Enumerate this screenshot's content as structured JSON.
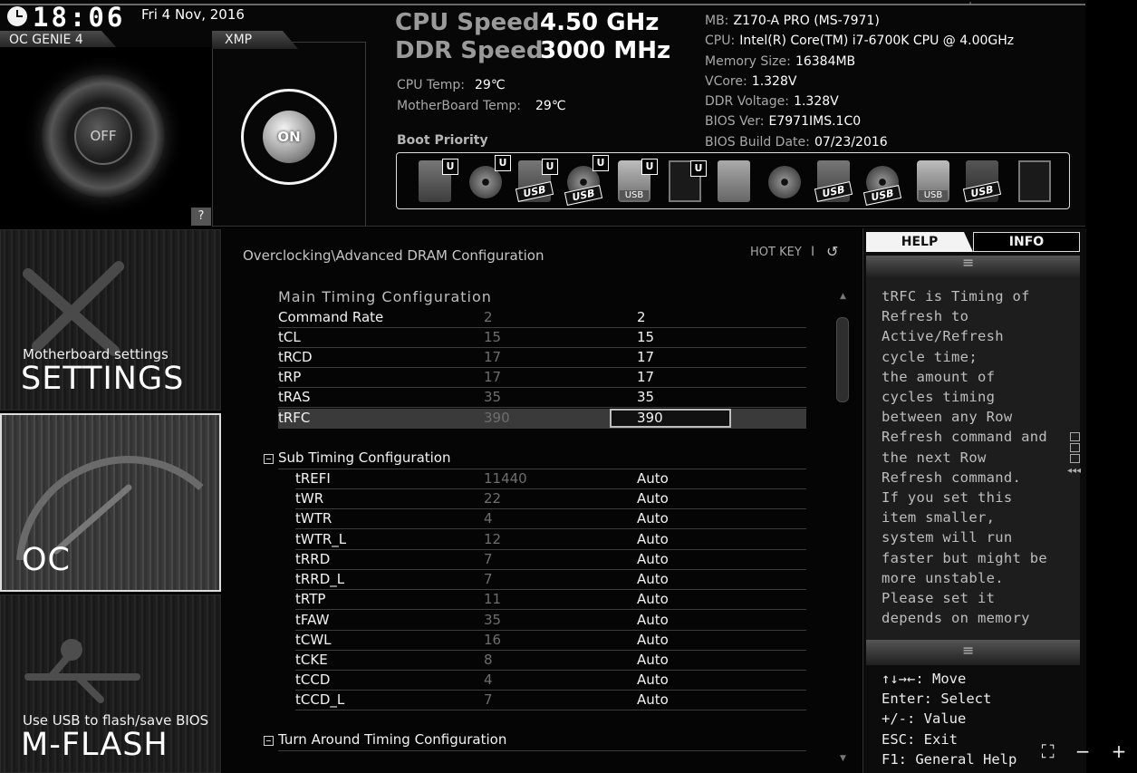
{
  "header": {
    "time": "18:06",
    "date": "Fri  4 Nov, 2016",
    "oc_genie_label": "OC GENIE 4",
    "oc_genie_state": "OFF",
    "xmp_label": "XMP",
    "xmp_state": "ON",
    "help_button": "?"
  },
  "speeds": {
    "cpu_label": "CPU Speed",
    "cpu_value": "4.50 GHz",
    "ddr_label": "DDR Speed",
    "ddr_value": "3000 MHz",
    "cpu_temp_label": "CPU Temp:",
    "cpu_temp_value": "29℃",
    "mb_temp_label": "MotherBoard Temp:",
    "mb_temp_value": "29℃"
  },
  "sysinfo": [
    {
      "label": "MB:",
      "value": "Z170-A PRO (MS-7971)"
    },
    {
      "label": "CPU:",
      "value": "Intel(R) Core(TM) i7-6700K CPU @ 4.00GHz"
    },
    {
      "label": "Memory Size:",
      "value": "16384MB"
    },
    {
      "label": "VCore:",
      "value": "1.328V"
    },
    {
      "label": "DDR Voltage:",
      "value": "1.328V"
    },
    {
      "label": "BIOS Ver:",
      "value": "E7971IMS.1C0"
    },
    {
      "label": "BIOS Build Date:",
      "value": "07/23/2016"
    }
  ],
  "boot": {
    "title": "Boot Priority",
    "u_mark": "U",
    "usb_label": "USB",
    "devices": [
      "hdd",
      "cd",
      "usb-hdd",
      "usb-cd",
      "usb-stick",
      "network",
      "hdd",
      "cd",
      "usb-hdd",
      "usb-cd",
      "usb-stick",
      "usb-floppy",
      "network"
    ]
  },
  "nav": {
    "settings_sub": "Motherboard settings",
    "settings_title": "SETTINGS",
    "oc_title": "OC",
    "mflash_sub": "Use USB to flash/save BIOS",
    "mflash_title": "M-FLASH"
  },
  "main": {
    "breadcrumb": "Overclocking\\Advanced DRAM Configuration",
    "hotkey": "HOT KEY",
    "hotkey_sep": "I",
    "back": "↺",
    "main_section": "Main Timing Configuration",
    "main_rows": [
      {
        "name": "Command Rate",
        "default": "2",
        "value": "2"
      },
      {
        "name": "tCL",
        "default": "15",
        "value": "15"
      },
      {
        "name": "tRCD",
        "default": "17",
        "value": "17"
      },
      {
        "name": "tRP",
        "default": "17",
        "value": "17"
      },
      {
        "name": "tRAS",
        "default": "35",
        "value": "35"
      },
      {
        "name": "tRFC",
        "default": "390",
        "value": "390"
      }
    ],
    "sub_section": "Sub Timing Configuration",
    "sub_rows": [
      {
        "name": "tREFI",
        "default": "11440",
        "value": "Auto"
      },
      {
        "name": "tWR",
        "default": "22",
        "value": "Auto"
      },
      {
        "name": "tWTR",
        "default": "4",
        "value": "Auto"
      },
      {
        "name": "tWTR_L",
        "default": "12",
        "value": "Auto"
      },
      {
        "name": "tRRD",
        "default": "7",
        "value": "Auto"
      },
      {
        "name": "tRRD_L",
        "default": "7",
        "value": "Auto"
      },
      {
        "name": "tRTP",
        "default": "11",
        "value": "Auto"
      },
      {
        "name": "tFAW",
        "default": "35",
        "value": "Auto"
      },
      {
        "name": "tCWL",
        "default": "16",
        "value": "Auto"
      },
      {
        "name": "tCKE",
        "default": "8",
        "value": "Auto"
      },
      {
        "name": "tCCD",
        "default": "4",
        "value": "Auto"
      },
      {
        "name": "tCCD_L",
        "default": "7",
        "value": "Auto"
      }
    ],
    "turn_section": "Turn Around Timing Configuration"
  },
  "help": {
    "tab_help": "HELP",
    "tab_info": "INFO",
    "text": "tRFC is Timing of\nRefresh to\nActive/Refresh\ncycle time;\nthe amount of\ncycles timing\nbetween any Row\nRefresh command and\nthe next Row\nRefresh command.\nIf you set this\nitem smaller,\nsystem will run\nfaster but might be\nmore unstable.\nPlease set it\ndepends on memory",
    "keys": "↑↓→←: Move\nEnter: Select\n+/-: Value\nESC: Exit\nF1: General Help"
  },
  "window": {
    "fit": "⛶",
    "zoom_out": "−",
    "zoom_in": "+"
  }
}
